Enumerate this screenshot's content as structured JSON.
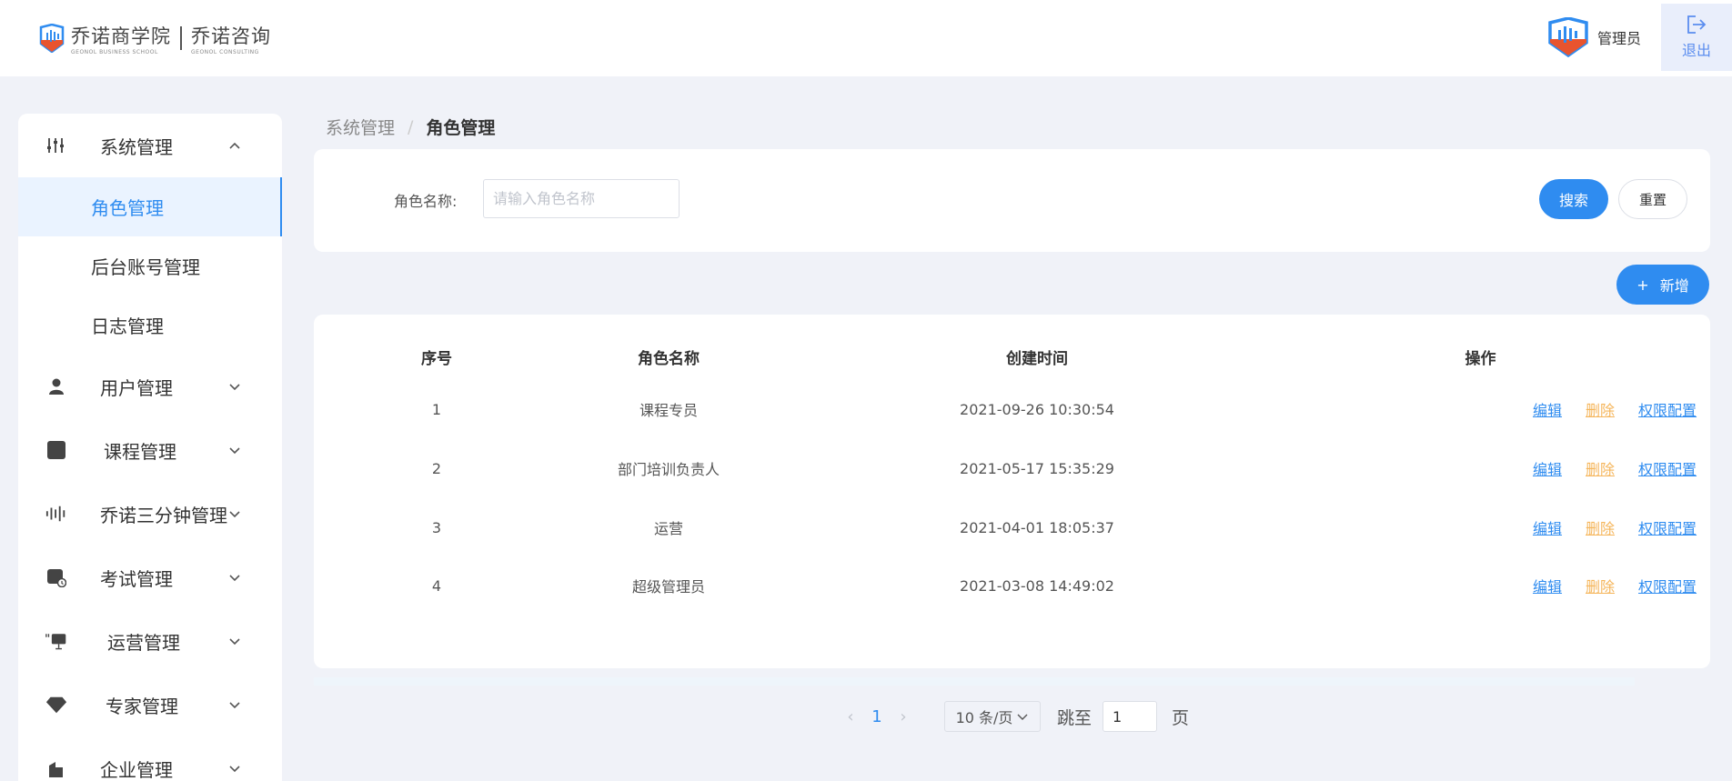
{
  "header": {
    "logo_text_1": "乔诺商学院",
    "logo_sub_1": "GEONOL BUSINESS SCHOOL",
    "logo_text_2": "乔诺咨询",
    "logo_sub_2": "GEONOL CONSULTING",
    "user_name": "管理员",
    "logout_label": "退出"
  },
  "colors": {
    "primary": "#2f8cf0",
    "danger_link": "#f5b55a",
    "active_bg": "#eaf3ff",
    "page_bg": "#f0f2f8"
  },
  "sidebar": {
    "groups": [
      {
        "label": "系统管理",
        "icon": "sliders-icon",
        "expanded": true,
        "children": [
          {
            "label": "角色管理",
            "active": true
          },
          {
            "label": "后台账号管理",
            "active": false
          },
          {
            "label": "日志管理",
            "active": false
          }
        ]
      },
      {
        "label": "用户管理",
        "icon": "user-icon",
        "expanded": false
      },
      {
        "label": "课程管理",
        "icon": "book-icon",
        "expanded": false
      },
      {
        "label": "乔诺三分钟管理",
        "icon": "audio-wave-icon",
        "expanded": false
      },
      {
        "label": "考试管理",
        "icon": "exam-icon",
        "expanded": false
      },
      {
        "label": "运营管理",
        "icon": "presentation-icon",
        "expanded": false
      },
      {
        "label": "专家管理",
        "icon": "diamond-icon",
        "expanded": false
      },
      {
        "label": "企业管理",
        "icon": "building-icon",
        "expanded": false
      }
    ]
  },
  "breadcrumb": {
    "parent": "系统管理",
    "separator": "/",
    "current": "角色管理"
  },
  "search": {
    "label": "角色名称:",
    "placeholder": "请输入角色名称",
    "value": "",
    "search_button": "搜索",
    "reset_button": "重置"
  },
  "add_button": {
    "plus": "+",
    "label": "新增"
  },
  "table": {
    "headers": [
      "序号",
      "角色名称",
      "创建时间",
      "操作"
    ],
    "rows": [
      {
        "index": "1",
        "name": "课程专员",
        "created": "2021-09-26 10:30:54"
      },
      {
        "index": "2",
        "name": "部门培训负责人",
        "created": "2021-05-17 15:35:29"
      },
      {
        "index": "3",
        "name": "运营",
        "created": "2021-04-01 18:05:37"
      },
      {
        "index": "4",
        "name": "超级管理员",
        "created": "2021-03-08 14:49:02"
      }
    ],
    "actions": {
      "edit": "编辑",
      "delete": "删除",
      "permissions": "权限配置"
    }
  },
  "pagination": {
    "prev": "‹",
    "current_page": "1",
    "next": "›",
    "page_size": "10 条/页",
    "jump_label": "跳至",
    "jump_value": "1",
    "jump_unit": "页"
  }
}
